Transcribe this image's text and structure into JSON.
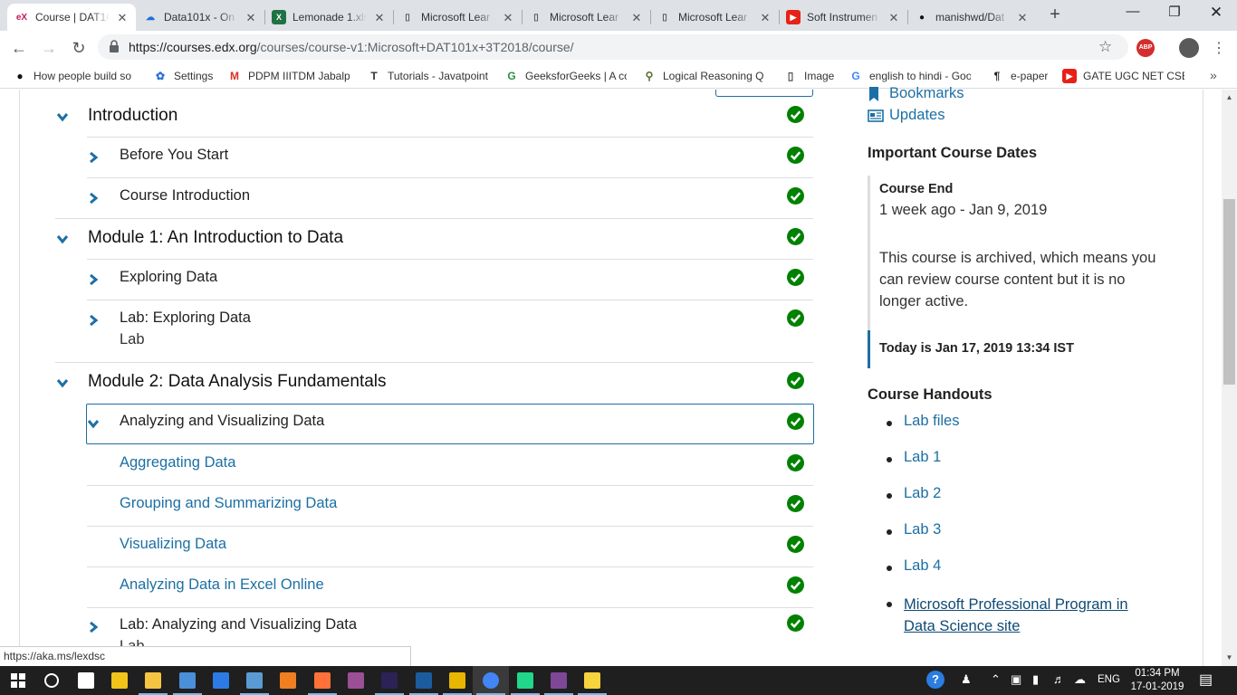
{
  "browser": {
    "tabs": [
      {
        "title": "Course | DAT101x",
        "icon": "edx-icon",
        "active": true
      },
      {
        "title": "Data101x - On",
        "icon": "onedrive-icon"
      },
      {
        "title": "Lemonade 1.xlsx",
        "icon": "excel-icon"
      },
      {
        "title": "Microsoft Lear",
        "icon": "document-icon"
      },
      {
        "title": "Microsoft Lear",
        "icon": "document-icon"
      },
      {
        "title": "Microsoft Lear",
        "icon": "document-icon"
      },
      {
        "title": "Soft Instrumen",
        "icon": "youtube-icon"
      },
      {
        "title": "manishwd/Dat",
        "icon": "github-icon"
      }
    ],
    "url_domain": "https://courses.edx.org",
    "url_path": "/courses/course-v1:Microsoft+DAT101x+3T2018/course/",
    "bookmarks": [
      {
        "label": "How people build so",
        "icon": "github-icon"
      },
      {
        "label": "Settings",
        "icon": "gear-icon"
      },
      {
        "label": "PDPM IIITDM Jabalpu",
        "icon": "gmail-icon"
      },
      {
        "label": "Tutorials - Javatpoint",
        "icon": "javatpoint-icon"
      },
      {
        "label": "GeeksforGeeks | A co",
        "icon": "geeksforgeeks-icon"
      },
      {
        "label": "Logical Reasoning Qu",
        "icon": "bookmark-icon"
      },
      {
        "label": "Image",
        "icon": "document-icon"
      },
      {
        "label": "english to hindi - Goo",
        "icon": "google-icon"
      },
      {
        "label": "e-paper",
        "icon": "epaper-icon"
      },
      {
        "label": "GATE UGC NET CSE L",
        "icon": "youtube-icon"
      }
    ],
    "status_url": "https://aka.ms/lexdsc",
    "abp_label": "ABP"
  },
  "outline": {
    "sections": [
      {
        "title": "Introduction",
        "subsections": [
          {
            "title": "Before You Start"
          },
          {
            "title": "Course Introduction"
          }
        ]
      },
      {
        "title": "Module 1: An Introduction to Data",
        "subsections": [
          {
            "title": "Exploring Data"
          },
          {
            "title": "Lab: Exploring Data",
            "type": "Lab"
          }
        ]
      },
      {
        "title": "Module 2: Data Analysis Fundamentals",
        "subsections": [
          {
            "title": "Analyzing and Visualizing Data",
            "units": [
              "Aggregating Data",
              "Grouping and Summarizing Data",
              "Visualizing Data",
              "Analyzing Data in Excel Online"
            ]
          },
          {
            "title": "Lab: Analyzing and Visualizing Data",
            "type": "Lab"
          }
        ]
      }
    ]
  },
  "sidebar": {
    "tools": [
      "Bookmarks",
      "Updates"
    ],
    "dates_heading": "Important Course Dates",
    "course_end_label": "Course End",
    "course_end_value": "1 week ago - Jan 9, 2019",
    "archived_note": "This course is archived, which means you can review course content but it is no longer active.",
    "today": "Today is Jan 17, 2019 13:34 IST",
    "handouts_heading": "Course Handouts",
    "handouts": [
      "Lab files",
      "Lab 1",
      "Lab 2",
      "Lab 3",
      "Lab 4",
      "Microsoft Professional Program in Data Science site"
    ]
  },
  "taskbar": {
    "lang": "ENG",
    "time": "01:34 PM",
    "date": "17-01-2019"
  },
  "colors": {
    "accent": "#1c6fa4",
    "check": "#008100",
    "taskbar": "#1f1f1f"
  }
}
